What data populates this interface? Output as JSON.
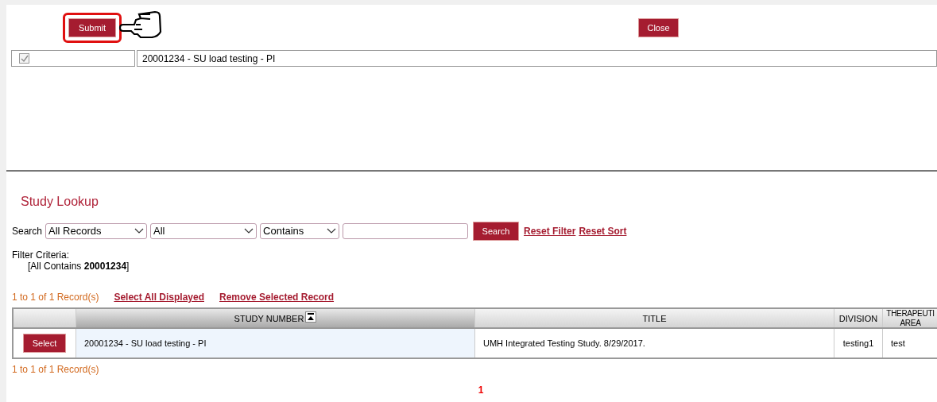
{
  "top_panel": {
    "submit_button": "Submit",
    "close_button": "Close",
    "selected_record": {
      "checked": true,
      "text": "20001234 - SU load testing - PI"
    }
  },
  "lookup": {
    "title": "Study Lookup",
    "search_label": "Search",
    "filters": [
      "All Records",
      "All",
      "Contains"
    ],
    "search_button": "Search",
    "links": [
      "Reset Filter",
      "Reset Sort"
    ],
    "filter_criteria_label": "Filter Criteria:",
    "filter_criteria": "[All Contains **20001234**]",
    "record_count_top": "1 to 1 of 1 Record(s)",
    "actions": [
      "Select All Displayed",
      "Remove Selected Record"
    ],
    "table": {
      "columns": [
        "",
        "STUDY NUMBER",
        "TITLE",
        "DIVISION",
        "THERAPEUTI\nAREA"
      ],
      "rows": [
        {
          "button": "Select",
          "study_number": "20001234 - SU load testing - PI",
          "title": "UMH Integrated Testing Study. 8/29/2017.",
          "division": "testing1",
          "therapeutic_area": "test"
        }
      ]
    },
    "record_count_bottom": "1 to 1 of 1 Record(s)",
    "pages": [
      {
        "label": "1",
        "selected": true
      }
    ]
  }
}
